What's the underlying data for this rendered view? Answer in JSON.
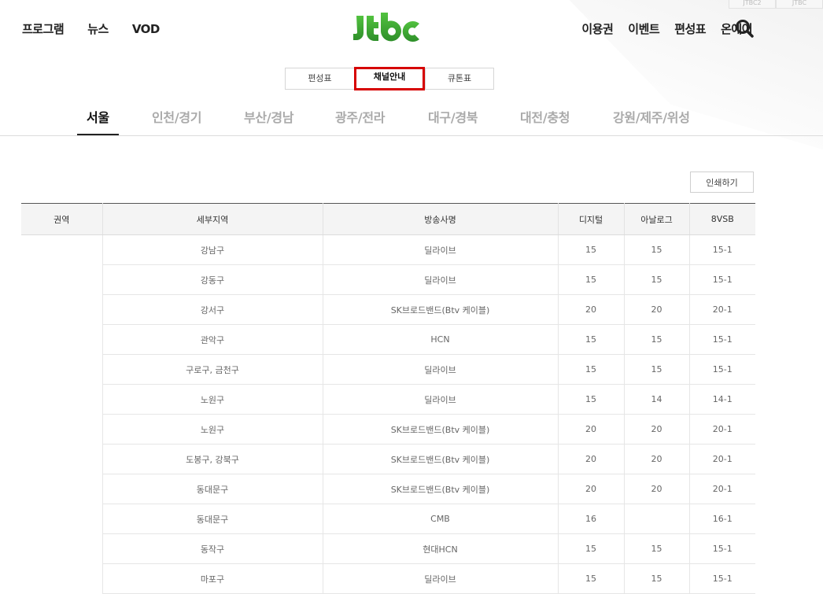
{
  "header": {
    "left_nav": [
      "프로그램",
      "뉴스",
      "VOD"
    ],
    "right_nav": [
      "이용권",
      "이벤트",
      "편성표",
      "온에어"
    ],
    "brand_color": "#3aa935"
  },
  "corner_tabs": [
    "JTBC2",
    "JTBC"
  ],
  "subtabs": [
    "편성표",
    "채널안내",
    "큐톤표"
  ],
  "active_subtab": "채널안내",
  "regions": [
    "서울",
    "인천/경기",
    "부산/경남",
    "광주/전라",
    "대구/경북",
    "대전/충청",
    "강원/제주/위성"
  ],
  "active_region": "서울",
  "print_label": "인쇄하기",
  "table": {
    "headers": [
      "권역",
      "세부지역",
      "방송사명",
      "디지털",
      "아날로그",
      "8VSB"
    ],
    "rows": [
      [
        "강남구",
        "딜라이브",
        "15",
        "15",
        "15-1"
      ],
      [
        "강동구",
        "딜라이브",
        "15",
        "15",
        "15-1"
      ],
      [
        "강서구",
        "SK브로드밴드(Btv 케이블)",
        "20",
        "20",
        "20-1"
      ],
      [
        "관악구",
        "HCN",
        "15",
        "15",
        "15-1"
      ],
      [
        "구로구, 금천구",
        "딜라이브",
        "15",
        "15",
        "15-1"
      ],
      [
        "노원구",
        "딜라이브",
        "15",
        "14",
        "14-1"
      ],
      [
        "노원구",
        "SK브로드밴드(Btv 케이블)",
        "20",
        "20",
        "20-1"
      ],
      [
        "도봉구, 강북구",
        "SK브로드밴드(Btv 케이블)",
        "20",
        "20",
        "20-1"
      ],
      [
        "동대문구",
        "SK브로드밴드(Btv 케이블)",
        "20",
        "20",
        "20-1"
      ],
      [
        "동대문구",
        "CMB",
        "16",
        "",
        "16-1"
      ],
      [
        "동작구",
        "현대HCN",
        "15",
        "15",
        "15-1"
      ],
      [
        "마포구",
        "딜라이브",
        "15",
        "15",
        "15-1"
      ]
    ]
  }
}
